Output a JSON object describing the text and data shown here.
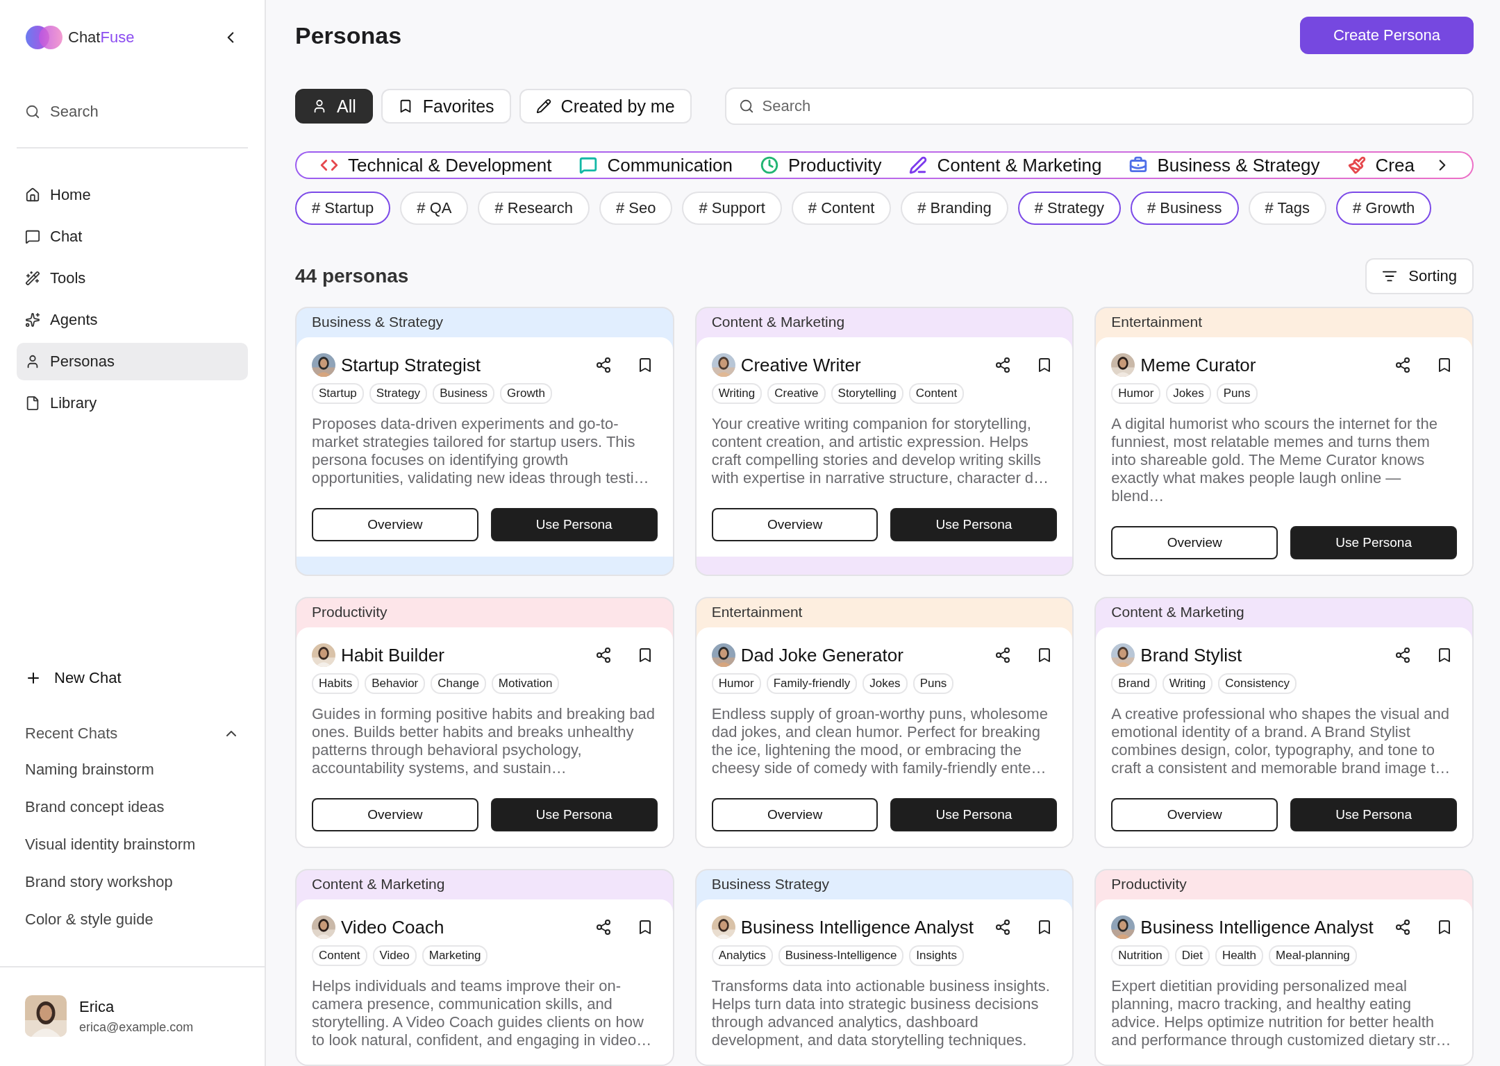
{
  "sidebar": {
    "brand": {
      "name": "Chat",
      "accent": "Fuse"
    },
    "search": {
      "placeholder": "Search"
    },
    "nav": [
      {
        "label": "Home",
        "selected": false
      },
      {
        "label": "Chat",
        "selected": false
      },
      {
        "label": "Tools",
        "selected": false
      },
      {
        "label": "Agents",
        "selected": false
      },
      {
        "label": "Personas",
        "selected": true
      },
      {
        "label": "Library",
        "selected": false
      }
    ],
    "new_chat": "New Chat",
    "recent": {
      "title": "Recent Chats",
      "expanded": true,
      "items": [
        "Naming brainstorm",
        "Brand concept ideas",
        "Visual identity brainstorm",
        "Brand story workshop",
        "Color & style guide"
      ]
    },
    "user": {
      "name": "Erica",
      "email": "erica@example.com"
    }
  },
  "page": {
    "title": "Personas",
    "create_button": "Create Persona"
  },
  "filters": [
    {
      "label": "All",
      "selected": true
    },
    {
      "label": "Favorites",
      "selected": false
    },
    {
      "label": "Created by me",
      "selected": false
    }
  ],
  "search": {
    "placeholder": "Search"
  },
  "categories": [
    {
      "label": "Technical & Development",
      "color": "#e5484d"
    },
    {
      "label": "Communication",
      "color": "#14b8a6"
    },
    {
      "label": "Productivity",
      "color": "#22b573"
    },
    {
      "label": "Content & Marketing",
      "color": "#7c3aed"
    },
    {
      "label": "Business & Strategy",
      "color": "#4f6fe8"
    },
    {
      "label": "Crea",
      "color": "#e5484d"
    }
  ],
  "tags": [
    {
      "label": "# Startup",
      "selected": true
    },
    {
      "label": "# QA",
      "selected": false
    },
    {
      "label": "# Research",
      "selected": false
    },
    {
      "label": "# Seo",
      "selected": false
    },
    {
      "label": "# Support",
      "selected": false
    },
    {
      "label": "# Content",
      "selected": false
    },
    {
      "label": "# Branding",
      "selected": false
    },
    {
      "label": "# Strategy",
      "selected": true
    },
    {
      "label": "# Business",
      "selected": true
    },
    {
      "label": "# Tags",
      "selected": false
    },
    {
      "label": "# Growth",
      "selected": true
    }
  ],
  "count": "44 personas",
  "sorting": "Sorting",
  "cards": [
    {
      "category": "Business & Strategy",
      "color": "#e1eefe",
      "name": "Startup Strategist",
      "tags": [
        "Startup",
        "Strategy",
        "Business",
        "Growth"
      ],
      "description": "Proposes data-driven experiments and go-to-market strategies tailored for startup users. This persona focuses on identifying growth opportunities, validating new ideas through testi…",
      "actions": [
        "Overview",
        "Use Persona"
      ]
    },
    {
      "category": "Content & Marketing",
      "color": "#f2e5fb",
      "name": "Creative Writer",
      "tags": [
        "Writing",
        "Creative",
        "Storytelling",
        "Content"
      ],
      "description": "Your creative writing companion for storytelling, content creation, and artistic expression. Helps craft compelling stories and develop writing skills with expertise in narrative structure, character d…",
      "actions": [
        "Overview",
        "Use Persona"
      ]
    },
    {
      "category": "Entertainment",
      "color": "#fdeedf",
      "name": "Meme Curator",
      "tags": [
        "Humor",
        "Jokes",
        "Puns"
      ],
      "description": "A digital humorist who scours the internet for the funniest, most relatable memes and turns them into shareable gold. The Meme Curator knows exactly what makes people laugh online — blend…",
      "actions": [
        "Overview",
        "Use Persona"
      ]
    },
    {
      "category": "Productivity",
      "color": "#fde5e9",
      "name": "Habit Builder",
      "tags": [
        "Habits",
        "Behavior",
        "Change",
        "Motivation"
      ],
      "description": "Guides in forming positive habits and breaking bad ones. Builds better habits and breaks unhealthy patterns through behavioral psychology, accountability systems, and sustain…",
      "actions": [
        "Overview",
        "Use Persona"
      ]
    },
    {
      "category": "Entertainment",
      "color": "#fdeedf",
      "name": "Dad Joke Generator",
      "tags": [
        "Humor",
        "Family-friendly",
        "Jokes",
        "Puns"
      ],
      "description": "Endless supply of groan-worthy puns, wholesome dad jokes, and clean humor. Perfect for breaking the ice, lightening the mood, or embracing the cheesy side of comedy with family-friendly ente…",
      "actions": [
        "Overview",
        "Use Persona"
      ]
    },
    {
      "category": "Content & Marketing",
      "color": "#f2e5fb",
      "name": "Brand Stylist",
      "tags": [
        "Brand",
        "Writing",
        "Consistency"
      ],
      "description": "A creative professional who shapes the visual and emotional identity of a brand. A Brand Stylist combines design, color, typography, and tone to craft a consistent and memorable brand image t…",
      "actions": [
        "Overview",
        "Use Persona"
      ]
    },
    {
      "category": "Content & Marketing",
      "color": "#f2e5fb",
      "name": "Video Coach",
      "tags": [
        "Content",
        "Video",
        "Marketing"
      ],
      "description": "Helps individuals and teams improve their on-camera presence, communication skills, and storytelling. A Video Coach guides clients on how to look natural, confident, and engaging in video…"
    },
    {
      "category": "Business Strategy",
      "color": "#e1eefe",
      "name": "Business Intelligence Analyst",
      "tags": [
        "Analytics",
        "Business-Intelligence",
        "Insights"
      ],
      "description": "Transforms data into actionable business insights. Helps turn data into strategic business decisions through advanced analytics, dashboard development, and data storytelling techniques."
    },
    {
      "category": "Productivity",
      "color": "#fde5e9",
      "name": "Business Intelligence Analyst",
      "tags": [
        "Nutrition",
        "Diet",
        "Health",
        "Meal-planning"
      ],
      "description": "Expert dietitian providing personalized meal planning, macro tracking, and healthy eating advice. Helps optimize nutrition for better health and performance through customized dietary str…"
    }
  ]
}
